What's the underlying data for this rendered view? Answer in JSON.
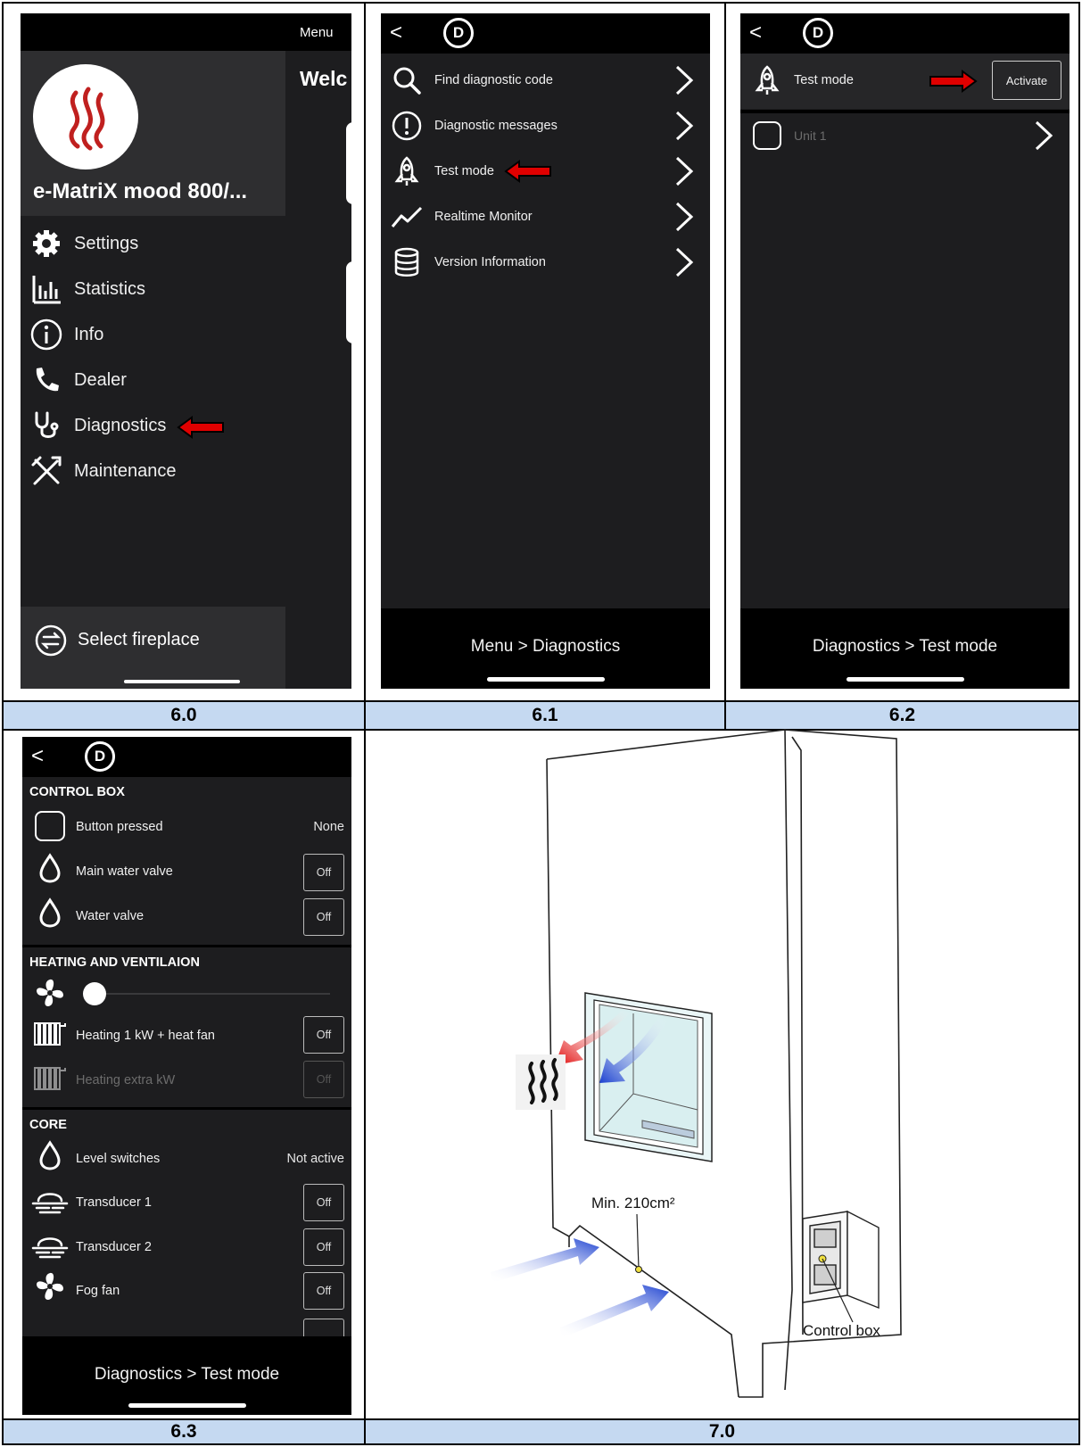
{
  "panels": {
    "p60": {
      "label": "6.0",
      "menu_tab": "Menu",
      "welcome_fragment": "Welc",
      "device_name": "e-MatriX mood 800/...",
      "items": [
        {
          "label": "Settings",
          "icon": "gear-icon"
        },
        {
          "label": "Statistics",
          "icon": "bar-chart-icon"
        },
        {
          "label": "Info",
          "icon": "info-icon"
        },
        {
          "label": "Dealer",
          "icon": "phone-icon"
        },
        {
          "label": "Diagnostics",
          "icon": "stethoscope-icon"
        },
        {
          "label": "Maintenance",
          "icon": "tools-icon"
        }
      ],
      "select_label": "Select fireplace"
    },
    "p61": {
      "label": "6.1",
      "items": [
        {
          "label": "Find diagnostic code",
          "icon": "search-icon"
        },
        {
          "label": "Diagnostic messages",
          "icon": "alert-icon"
        },
        {
          "label": "Test mode",
          "icon": "rocket-icon"
        },
        {
          "label": "Realtime Monitor",
          "icon": "trend-icon"
        },
        {
          "label": "Version Information",
          "icon": "database-icon"
        }
      ],
      "breadcrumb": "Menu > Diagnostics"
    },
    "p62": {
      "label": "6.2",
      "title": "Test mode",
      "activate": "Activate",
      "unit": "Unit 1",
      "breadcrumb": "Diagnostics > Test mode"
    },
    "p63": {
      "label": "6.3",
      "section_control": "CONTROL BOX",
      "button_pressed": "Button pressed",
      "button_pressed_value": "None",
      "main_water_valve": "Main water valve",
      "water_valve": "Water valve",
      "section_heating": "HEATING AND VENTILAION",
      "heating1": "Heating 1 kW + heat fan",
      "heating_extra": "Heating extra kW",
      "section_core": "CORE",
      "level_switches": "Level switches",
      "level_switches_value": "Not active",
      "transducer1": "Transducer 1",
      "transducer2": "Transducer 2",
      "fog_fan": "Fog fan",
      "off": "Off",
      "breadcrumb": "Diagnostics > Test mode"
    },
    "p70": {
      "label": "7.0",
      "min_area": "Min. 210cm²",
      "control_box": "Control box"
    }
  },
  "colors": {
    "panel_bg": "#1d1d1f",
    "label_bg": "#c5d9f1",
    "red_arrow": "#e00000",
    "blue_arrow": "#1a3fd0",
    "logo_red": "#c0201f"
  }
}
